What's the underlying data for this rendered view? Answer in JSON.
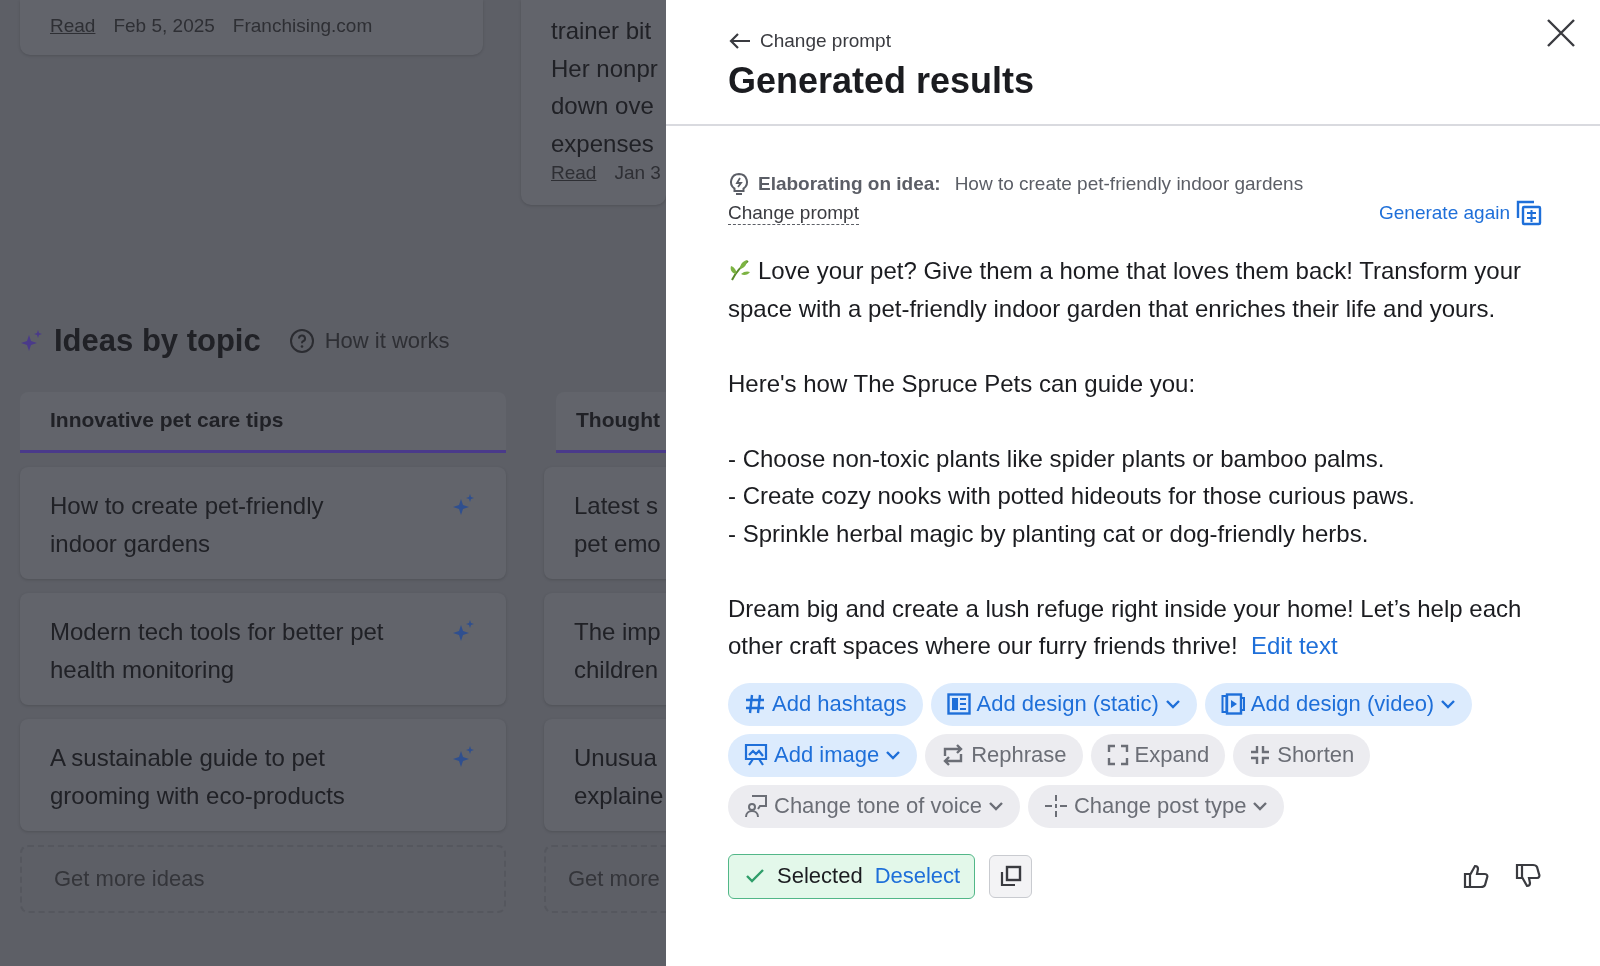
{
  "background": {
    "news_cards": [
      {
        "read": "Read",
        "date": "Feb 5, 2025",
        "source": "Franchising.com"
      },
      {
        "lines": [
          "trainer bit",
          "Her nonpr",
          "down ove",
          "expenses"
        ],
        "read": "Read",
        "date": "Jan 3"
      }
    ],
    "ideas": {
      "title": "Ideas by topic",
      "help": "How it works",
      "columns": [
        {
          "tab": "Innovative pet care tips",
          "ideas": [
            "How to create pet-friendly indoor gardens",
            "Modern tech tools for better pet health monitoring",
            "A sustainable guide to pet grooming with eco-products"
          ],
          "more": "Get more ideas"
        },
        {
          "tab": "Thought",
          "ideas": [
            "Latest s pet emo",
            "The imp children",
            "Unusua explaine"
          ],
          "more": "Get more"
        }
      ]
    }
  },
  "panel": {
    "back": "Change prompt",
    "title": "Generated results",
    "idea_label": "Elaborating on idea:",
    "idea": "How to create pet-friendly indoor gardens",
    "change_prompt": "Change prompt",
    "generate_again": "Generate again",
    "paragraphs": [
      [
        "Love your pet? Give them a home that loves them back! Transform your space with a pet-friendly indoor garden that enriches their life and yours."
      ],
      [
        "Here's how The Spruce Pets can guide you:"
      ],
      [
        "- Choose non-toxic plants like spider plants or bamboo palms.",
        "- Create cozy nooks with potted hideouts for those curious paws.",
        "- Sprinkle herbal magic by planting cat or dog-friendly herbs."
      ],
      [
        "Dream big and create a lush refuge right inside your home! Let’s help each other craft spaces where our furry friends thrive!"
      ]
    ],
    "edit_text": "Edit text",
    "actions": [
      {
        "label": "Add hashtags",
        "kind": "accent",
        "dropdown": false
      },
      {
        "label": "Add design (static)",
        "kind": "accent",
        "dropdown": true
      },
      {
        "label": "Add design (video)",
        "kind": "accent",
        "dropdown": true
      },
      {
        "label": "Add image",
        "kind": "accent",
        "dropdown": true
      },
      {
        "label": "Rephrase",
        "kind": "plain",
        "dropdown": false
      },
      {
        "label": "Expand",
        "kind": "plain",
        "dropdown": false
      },
      {
        "label": "Shorten",
        "kind": "plain",
        "dropdown": false
      },
      {
        "label": "Change tone of voice",
        "kind": "plain",
        "dropdown": true
      },
      {
        "label": "Change post type",
        "kind": "plain",
        "dropdown": true
      }
    ],
    "selection": {
      "label": "Selected",
      "action": "Deselect",
      "selected": true
    }
  }
}
